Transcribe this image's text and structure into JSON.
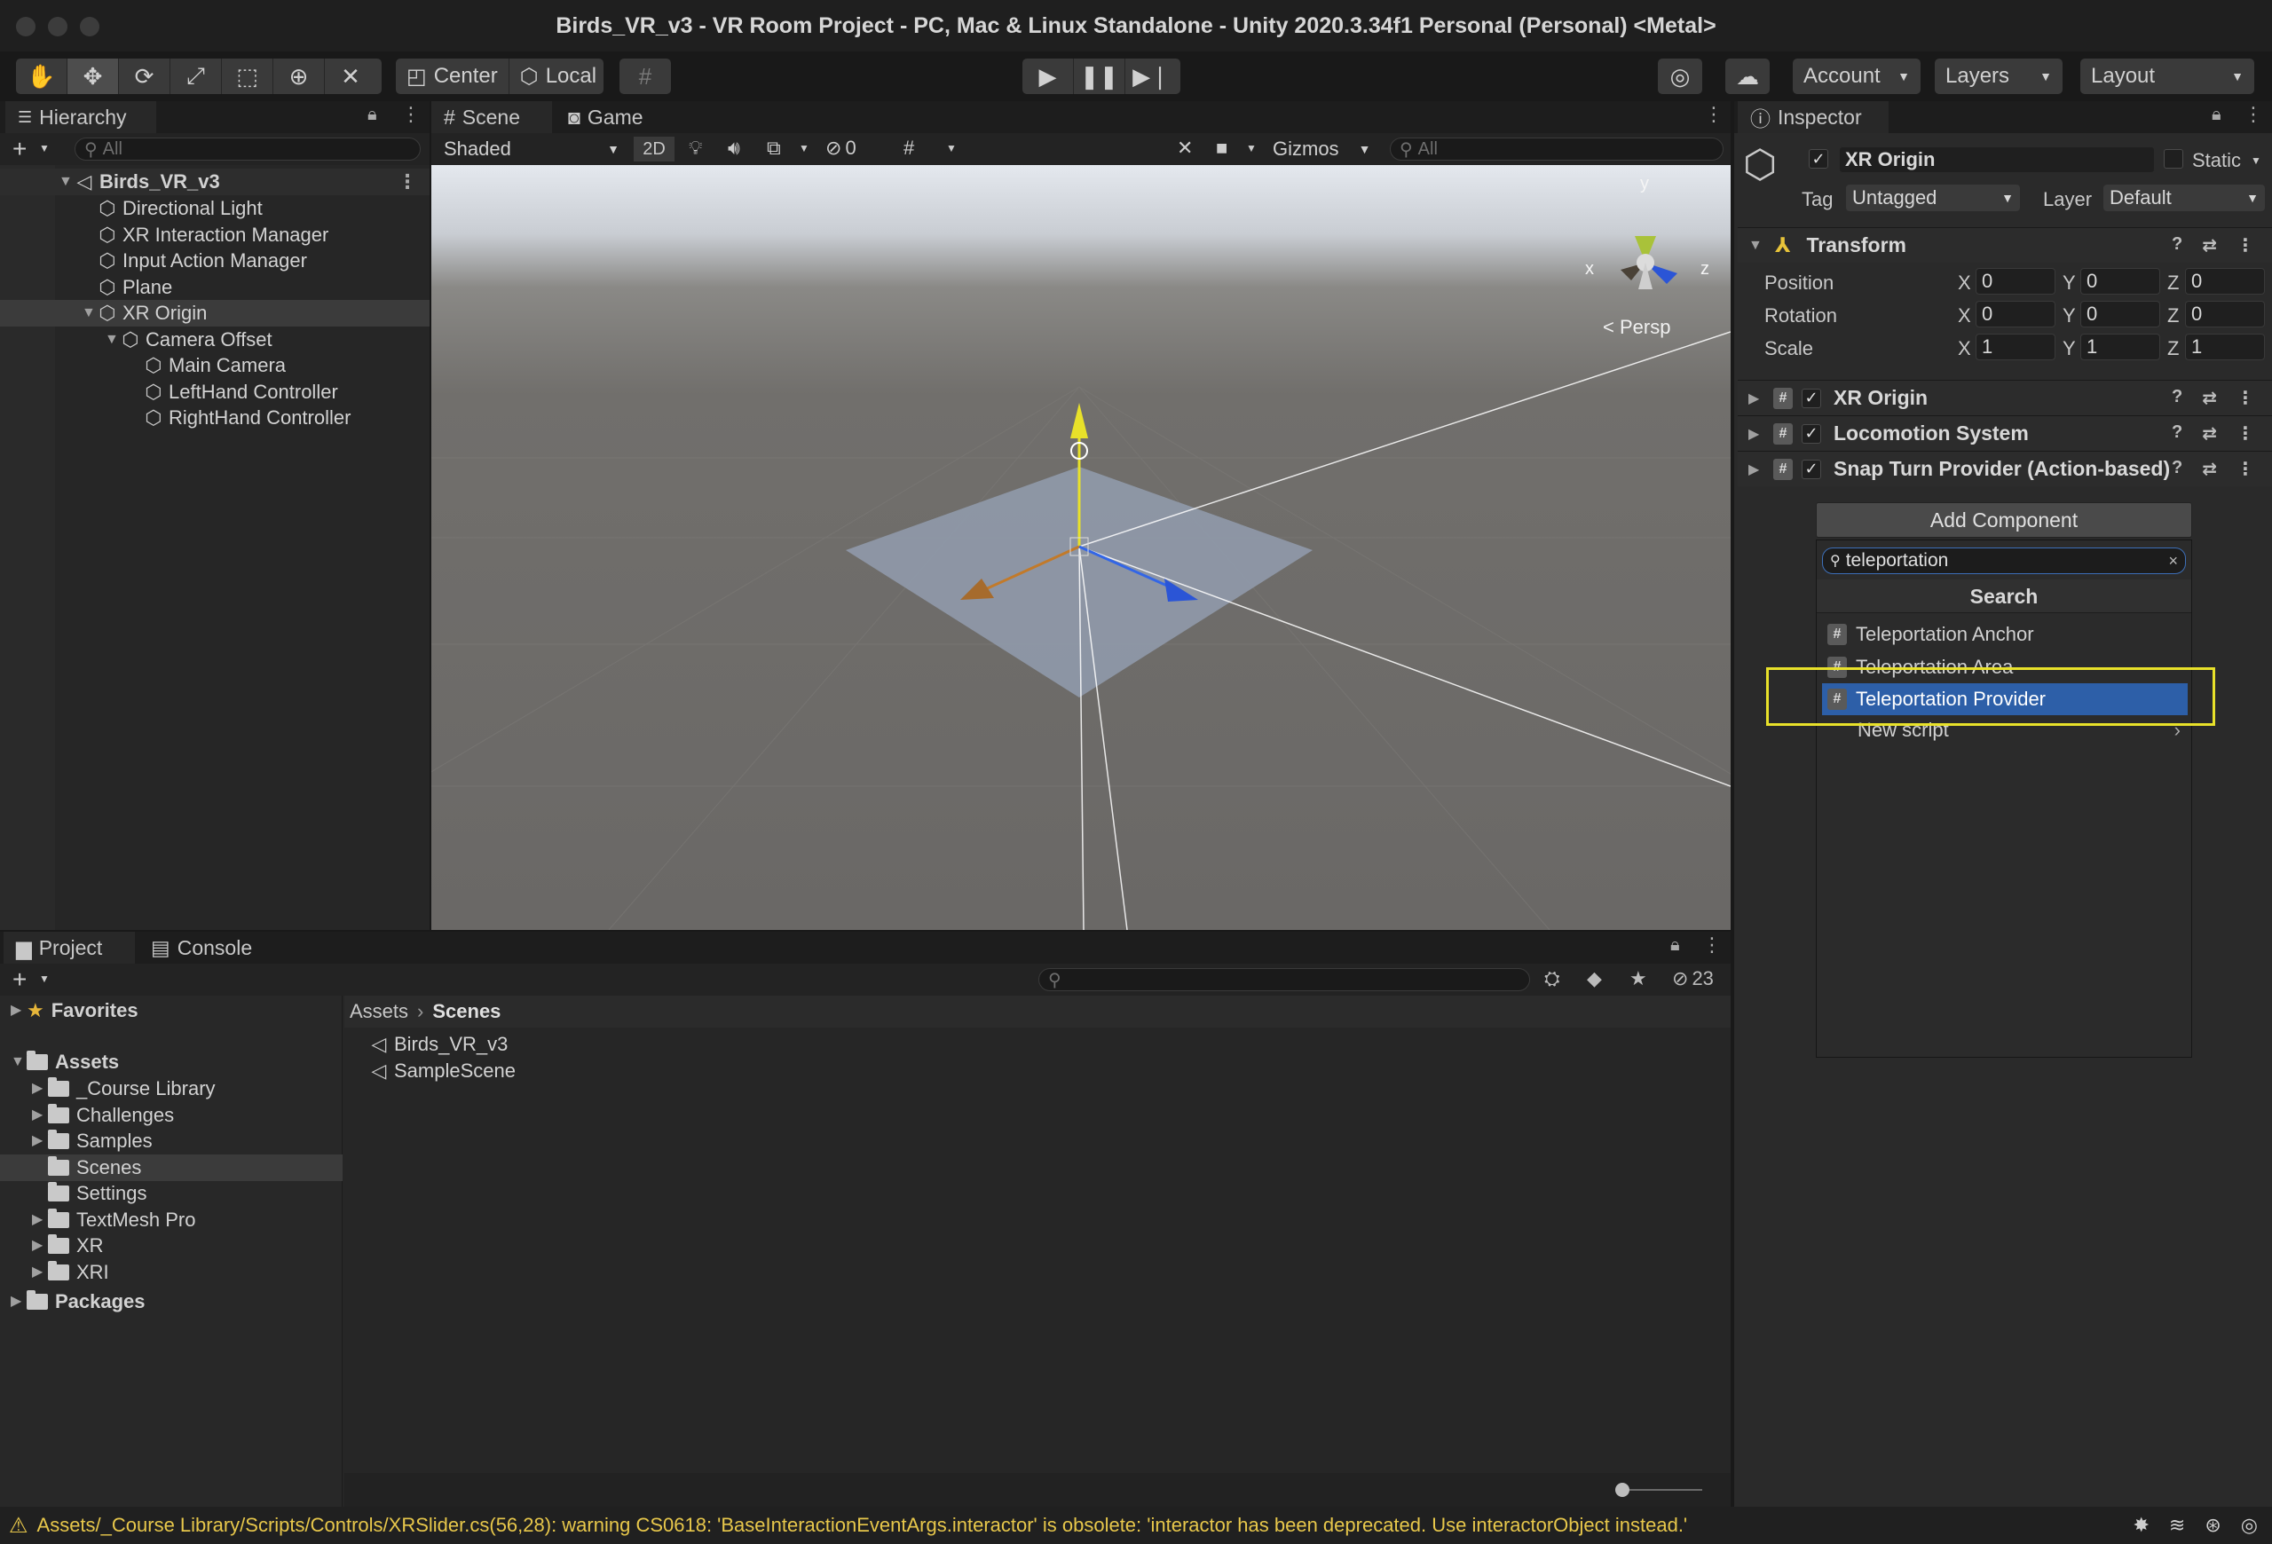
{
  "window": {
    "title": "Birds_VR_v3 - VR Room Project - PC, Mac & Linux Standalone - Unity 2020.3.34f1 Personal (Personal) <Metal>"
  },
  "toolbar": {
    "pivot_label": "Center",
    "space_label": "Local",
    "account_label": "Account",
    "layers_label": "Layers",
    "layout_label": "Layout"
  },
  "hierarchy": {
    "tab_label": "Hierarchy",
    "search_placeholder": "All",
    "scene_name": "Birds_VR_v3",
    "items": [
      {
        "label": "Directional Light",
        "depth": 1,
        "expandable": false
      },
      {
        "label": "XR Interaction Manager",
        "depth": 1,
        "expandable": false
      },
      {
        "label": "Input Action Manager",
        "depth": 1,
        "expandable": false
      },
      {
        "label": "Plane",
        "depth": 1,
        "expandable": false
      },
      {
        "label": "XR Origin",
        "depth": 1,
        "expandable": true,
        "selected": true
      },
      {
        "label": "Camera Offset",
        "depth": 2,
        "expandable": true
      },
      {
        "label": "Main Camera",
        "depth": 3,
        "expandable": false
      },
      {
        "label": "LeftHand Controller",
        "depth": 3,
        "expandable": false
      },
      {
        "label": "RightHand Controller",
        "depth": 3,
        "expandable": false
      }
    ]
  },
  "scene": {
    "tab_scene": "Scene",
    "tab_game": "Game",
    "shading_mode": "Shaded",
    "mode_2d": "2D",
    "hidden_count": "0",
    "gizmos_label": "Gizmos",
    "search_placeholder": "All",
    "projection_label": "< Persp",
    "axis_x": "x",
    "axis_y": "y",
    "axis_z": "z"
  },
  "inspector": {
    "tab_label": "Inspector",
    "object_name": "XR Origin",
    "static_label": "Static",
    "tag_label": "Tag",
    "tag_value": "Untagged",
    "layer_label": "Layer",
    "layer_value": "Default",
    "transform": {
      "title": "Transform",
      "rows": [
        {
          "label": "Position",
          "x": "0",
          "y": "0",
          "z": "0"
        },
        {
          "label": "Rotation",
          "x": "0",
          "y": "0",
          "z": "0"
        },
        {
          "label": "Scale",
          "x": "1",
          "y": "1",
          "z": "1"
        }
      ]
    },
    "components": [
      {
        "title": "XR Origin"
      },
      {
        "title": "Locomotion System"
      },
      {
        "title": "Snap Turn Provider (Action-based)"
      }
    ],
    "add_component_label": "Add Component",
    "add_component_popup": {
      "search_value": "teleportation",
      "header": "Search",
      "results": [
        {
          "label": "Teleportation Anchor",
          "selected": false
        },
        {
          "label": "Teleportation Area",
          "selected": false
        },
        {
          "label": "Teleportation Provider",
          "selected": true
        }
      ],
      "new_script_label": "New script"
    }
  },
  "project": {
    "tab_project": "Project",
    "tab_console": "Console",
    "hidden_count": "23",
    "favorites_label": "Favorites",
    "assets_label": "Assets",
    "folders": [
      {
        "label": "_Course Library",
        "expandable": true
      },
      {
        "label": "Challenges",
        "expandable": true
      },
      {
        "label": "Samples",
        "expandable": true
      },
      {
        "label": "Scenes",
        "expandable": false,
        "selected": true
      },
      {
        "label": "Settings",
        "expandable": false
      },
      {
        "label": "TextMesh Pro",
        "expandable": true
      },
      {
        "label": "XR",
        "expandable": true
      },
      {
        "label": "XRI",
        "expandable": true
      }
    ],
    "packages_label": "Packages",
    "breadcrumb": [
      "Assets",
      "Scenes"
    ],
    "files": [
      "Birds_VR_v3",
      "SampleScene"
    ]
  },
  "status": {
    "message": "Assets/_Course Library/Scripts/Controls/XRSlider.cs(56,28): warning CS0618: 'BaseInteractionEventArgs.interactor' is obsolete: 'interactor has been deprecated. Use interactorObject instead.'"
  },
  "colors": {
    "selection_blue": "#2d5fa8",
    "highlight_yellow": "#e8e12a",
    "warning_yellow": "#e7c74b"
  }
}
